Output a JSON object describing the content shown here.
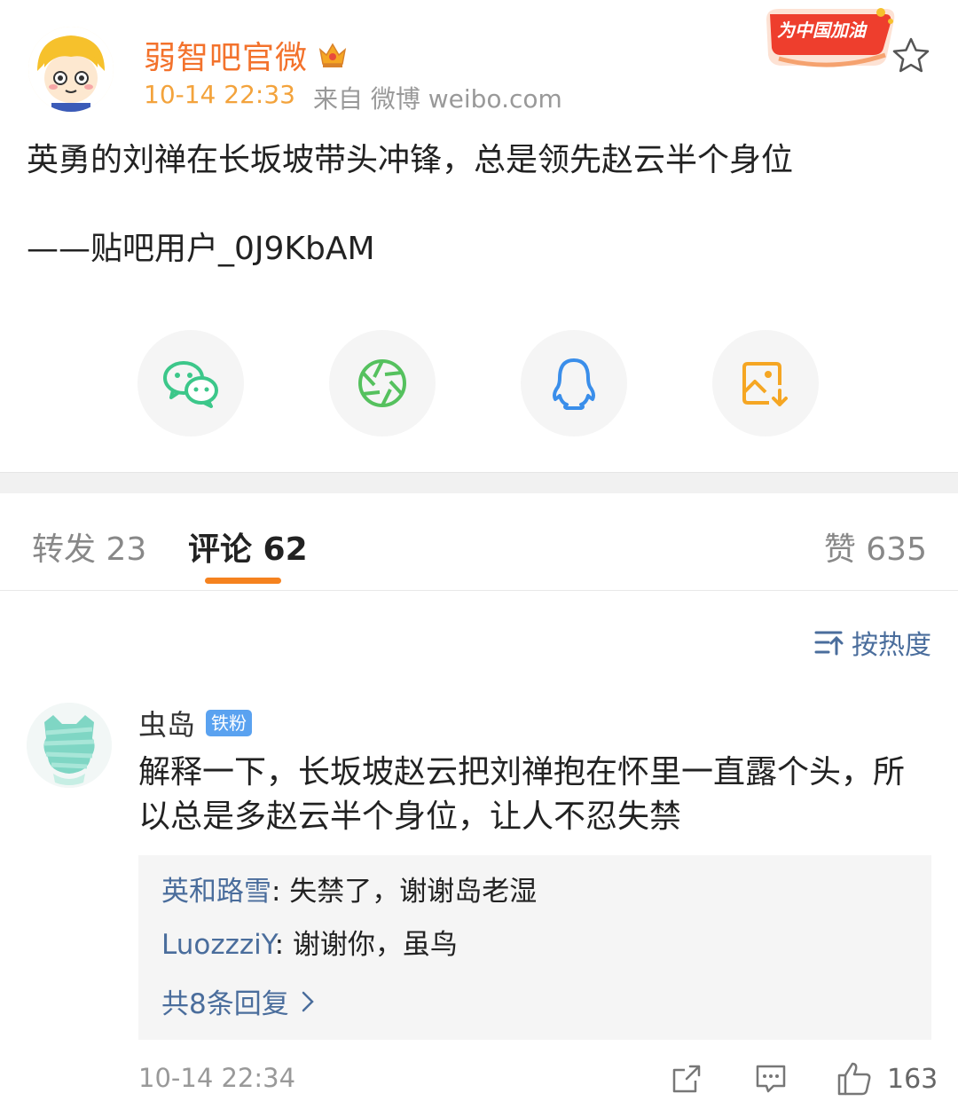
{
  "post": {
    "author": "弱智吧官微",
    "time": "10-14 22:33",
    "source": "来自 微博 weibo.com",
    "badge_text": "为中国加油",
    "text": "英勇的刘禅在长坂坡带头冲锋，总是领先赵云半个身位",
    "signature": "——贴吧用户_0J9KbAM"
  },
  "share": [
    {
      "icon": "wechat-icon",
      "color": "#3cc78a"
    },
    {
      "icon": "moments-icon",
      "color": "#55c15e"
    },
    {
      "icon": "qq-icon",
      "color": "#3a8eea"
    },
    {
      "icon": "save-image-icon",
      "color": "#f5a623"
    }
  ],
  "tabs": {
    "repost": "转发 23",
    "comments": "评论 62",
    "likes": "赞 635"
  },
  "sort_label": "按热度",
  "comment": {
    "author": "虫岛",
    "fan_badge": "铁粉",
    "text": "解释一下，长坂坡赵云把刘禅抱在怀里一直露个头，所以总是多赵云半个身位，让人不忍失禁",
    "replies": [
      {
        "name": "英和路雪",
        "text": ": 失禁了，谢谢岛老湿"
      },
      {
        "name": "LuozzziY",
        "text": ": 谢谢你，虽鸟"
      }
    ],
    "more_replies": "共8条回复",
    "time": "10-14 22:34",
    "likes": "163"
  },
  "colors": {
    "accent": "#f5821f",
    "link": "#4a6d9c"
  }
}
